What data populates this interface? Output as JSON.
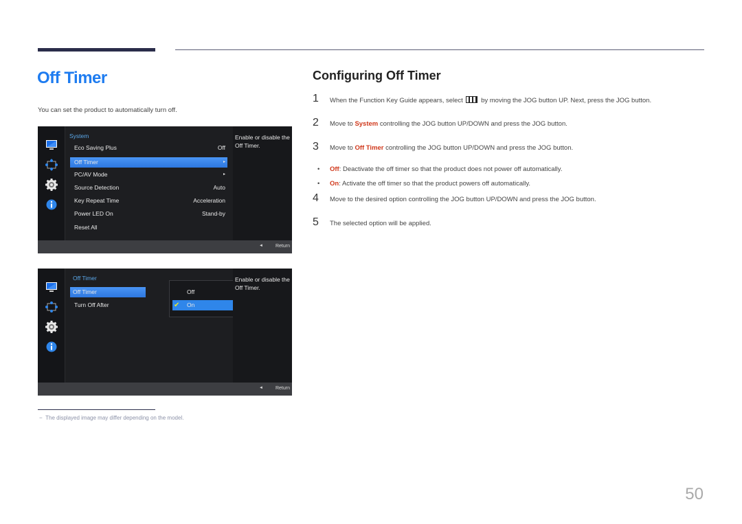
{
  "page": {
    "title": "Off Timer",
    "intro": "You can set the product to automatically turn off.",
    "page_number": "50",
    "footnote": "The displayed image may differ depending on the model.",
    "footnote_marker": "−"
  },
  "osd1": {
    "sidebar_icons": [
      "picture-icon",
      "resize-icon",
      "gear-icon",
      "info-icon"
    ],
    "menu_title": "System",
    "items": [
      {
        "label": "Eco Saving Plus",
        "value": "Off"
      },
      {
        "label": "Off Timer",
        "value": "▸",
        "selected": true
      },
      {
        "label": "PC/AV Mode",
        "value": "▸"
      },
      {
        "label": "Source Detection",
        "value": "Auto"
      },
      {
        "label": "Key Repeat Time",
        "value": "Acceleration"
      },
      {
        "label": "Power LED On",
        "value": "Stand-by"
      },
      {
        "label": "Reset All",
        "value": ""
      }
    ],
    "description": "Enable or disable the Off Timer.",
    "footer_return": "Return",
    "footer_arrow": "◄"
  },
  "osd2": {
    "menu_title": "Off Timer",
    "items": [
      {
        "label": "Off Timer",
        "selected": true
      },
      {
        "label": "Turn Off After"
      }
    ],
    "popup_options": [
      {
        "label": "Off",
        "selected": false
      },
      {
        "label": "On",
        "selected": true,
        "check": "✔"
      }
    ],
    "description": "Enable or disable the Off Timer.",
    "footer_return": "Return",
    "footer_arrow": "◄"
  },
  "section": {
    "title": "Configuring Off Timer",
    "steps": [
      {
        "num": "1",
        "pre": "When the Function Key Guide appears, select ",
        "icon": "menu-icon",
        "post": " by moving the JOG button UP. Next, press the JOG button."
      },
      {
        "num": "2",
        "pre": "Move to ",
        "hl": "System",
        "post": " controlling the JOG button UP/DOWN and press the JOG button."
      },
      {
        "num": "3",
        "pre": "Move to ",
        "hl": "Off Timer",
        "post": " controlling the JOG button UP/DOWN and press the JOG button."
      },
      {
        "num": "4",
        "text": "Move to the desired option controlling the JOG button UP/DOWN and press the JOG button."
      },
      {
        "num": "5",
        "text": "The selected option will be applied."
      }
    ],
    "bullets": [
      {
        "hl": "Off",
        "text": ": Deactivate the off timer so that the product does not power off automatically."
      },
      {
        "hl": "On",
        "text": ": Activate the off timer so that the product powers off automatically."
      }
    ],
    "bullet_char": "•"
  },
  "colors": {
    "title_blue": "#1e7cf0",
    "highlight_red": "#d0391c",
    "osd_selected": "#3b86ea",
    "menu_title_blue": "#5ba8ea",
    "check_yellow": "#e8e830"
  }
}
